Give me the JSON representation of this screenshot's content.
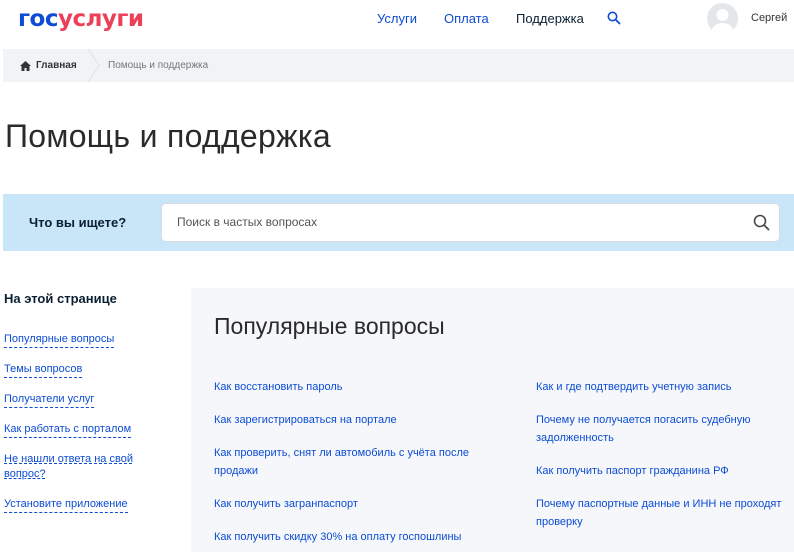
{
  "header": {
    "logo_part1": "гос",
    "logo_part2": "услуги",
    "nav": [
      "Услуги",
      "Оплата",
      "Поддержка"
    ],
    "search_icon": "search-icon",
    "user_name": "Сергей"
  },
  "breadcrumb": {
    "home_icon": "home-icon",
    "home": "Главная",
    "current": "Помощь и поддержка"
  },
  "page_title": "Помощь и поддержка",
  "search": {
    "label": "Что вы ищете?",
    "placeholder": "Поиск в частых вопросах",
    "value": ""
  },
  "sidebar": {
    "title": "На этой странице",
    "links": [
      "Популярные вопросы",
      "Темы вопросов",
      "Получатели услуг",
      "Как работать с порталом",
      "Не нашли ответа на свой вопрос?",
      "Установите приложение"
    ]
  },
  "popular": {
    "title": "Популярные вопросы",
    "left": [
      "Как восстановить пароль",
      "Как зарегистрироваться на портале",
      "Как проверить, снят ли автомобиль с учёта после продажи",
      "Как получить загранпаспорт",
      "Как получить скидку 30% на оплату госпошлины"
    ],
    "right": [
      "Как и где подтвердить учетную запись",
      "Почему не получается погасить судебную задолженность",
      "Как получить паспорт гражданина РФ",
      "Почему паспортные данные и ИНН не проходят проверку"
    ]
  },
  "colors": {
    "brand_blue": "#0d4cd3",
    "brand_red": "#ee3f58",
    "search_panel": "#c8e6f8",
    "section_bg": "#f5f7fa"
  }
}
